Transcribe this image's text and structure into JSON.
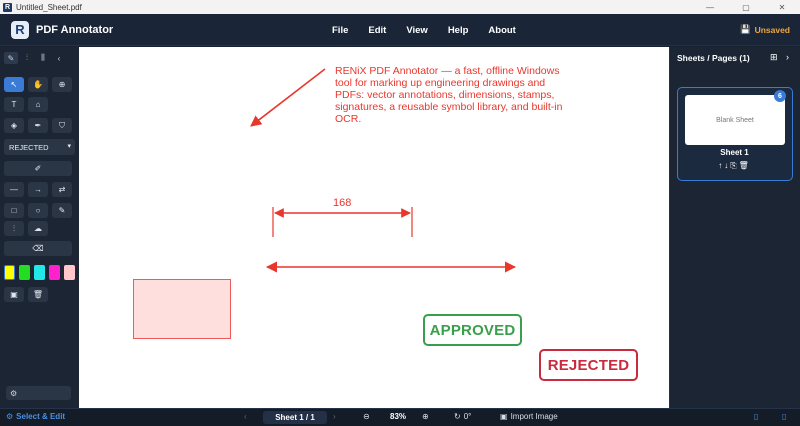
{
  "window": {
    "title": "Untitled_Sheet.pdf",
    "controls": {
      "minimize": "—",
      "maximize": "▢",
      "close": "✕"
    }
  },
  "app": {
    "logo": "R",
    "name": "PDF Annotator",
    "menu": [
      "File",
      "Edit",
      "View",
      "Help",
      "About"
    ],
    "status_badge": "Unsaved"
  },
  "tools": {
    "stamp_select_value": "REJECTED",
    "colors": [
      "#ffff00",
      "#22dd22",
      "#22e8e8",
      "#ff22cc",
      "#ffc6cc"
    ],
    "selected_color": "#ffff00"
  },
  "canvas": {
    "note": "RENiX PDF Annotator — a fast, offline Windows tool for marking up engineering drawings and PDFs: vector annotations, dimensions, stamps, signatures, a reusable symbol library, and built-in OCR.",
    "dimension_value": "168",
    "stamp_approved": "APPROVED",
    "stamp_rejected": "REJECTED",
    "annotation_color": "#e8372d"
  },
  "pages_panel": {
    "title": "Sheets / Pages (1)",
    "sheets": [
      {
        "thumb_label": "Blank Sheet",
        "name": "Sheet 1",
        "badge": "6"
      }
    ]
  },
  "statusbar": {
    "mode": "Select & Edit",
    "sheet_indicator": "Sheet 1 / 1",
    "zoom": "83%",
    "rotation": "0°",
    "import": "Import Image"
  }
}
